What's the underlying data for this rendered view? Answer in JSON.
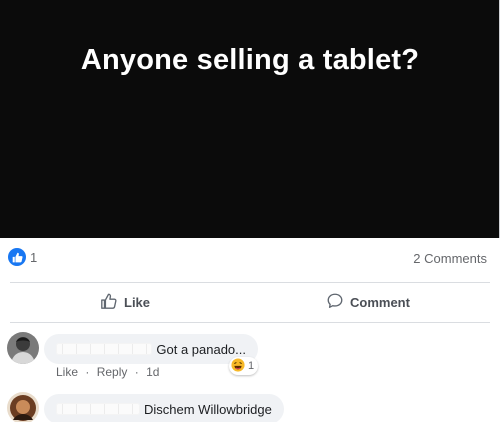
{
  "post": {
    "text": "Anyone selling a tablet?"
  },
  "stats": {
    "like_count": "1",
    "comments_count": "2 Comments"
  },
  "actions": {
    "like_label": "Like",
    "comment_label": "Comment"
  },
  "comments": [
    {
      "text": "Got a panado...",
      "actions": {
        "like": "Like",
        "reply": "Reply",
        "time": "1d",
        "separator": "·"
      },
      "reaction_count": "1"
    },
    {
      "text": "Dischem Willowbridge"
    }
  ],
  "colors": {
    "image_bg": "#0b0b0b",
    "brand_blue": "#1877f2",
    "bubble_bg": "#f0f2f5",
    "muted_text": "#65676b"
  },
  "icons": {
    "like_badge": "thumbs-up-icon",
    "like_action": "thumbs-up-outline-icon",
    "comment_action": "comment-bubble-icon",
    "reaction": "laugh-emoji-icon"
  }
}
